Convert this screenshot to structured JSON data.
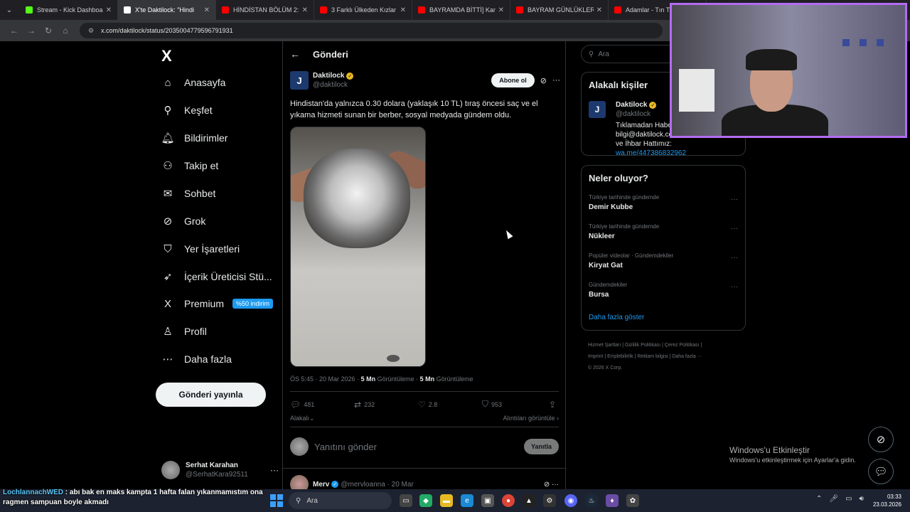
{
  "browser": {
    "tabs": [
      {
        "title": "Stream - Kick Dashboard",
        "color": "#53fc18",
        "active": false
      },
      {
        "title": "X'te Daktilock: \"Hindi",
        "color": "#ffffff",
        "active": true
      },
      {
        "title": "HİNDİSTAN BÖLÜM 2: VA",
        "color": "#ff0000",
        "active": false
      },
      {
        "title": "3 Farklı Ülkeden Kızlar Arı",
        "color": "#ff0000",
        "active": false
      },
      {
        "title": "BAYRAMDA BİTTİ] Kanser",
        "color": "#ff0000",
        "active": false
      },
      {
        "title": "BAYRAM GÜNLÜKLERİ 🔵",
        "color": "#ff0000",
        "active": false
      },
      {
        "title": "Adamlar - Tın Tın (O",
        "color": "#ff0000",
        "active": false
      }
    ],
    "url": "x.com/daktilock/status/2035004779596791931"
  },
  "sidebar": {
    "logo": "X",
    "items": [
      {
        "label": "Anasayfa",
        "icon": "home-icon",
        "glyph": "⌂"
      },
      {
        "label": "Keşfet",
        "icon": "search-icon",
        "glyph": "⚲"
      },
      {
        "label": "Bildirimler",
        "icon": "bell-icon",
        "glyph": "🔔︎"
      },
      {
        "label": "Takip et",
        "icon": "add-person-icon",
        "glyph": "⚇"
      },
      {
        "label": "Sohbet",
        "icon": "envelope-icon",
        "glyph": "✉"
      },
      {
        "label": "Grok",
        "icon": "grok-icon",
        "glyph": "⊘"
      },
      {
        "label": "Yer İşaretleri",
        "icon": "bookmark-icon",
        "glyph": "⛉"
      },
      {
        "label": "İçerik Üreticisi Stü...",
        "icon": "rocket-icon",
        "glyph": "➶"
      },
      {
        "label": "Premium",
        "icon": "x-premium-icon",
        "glyph": "X"
      },
      {
        "label": "Profil",
        "icon": "person-icon",
        "glyph": "♙"
      },
      {
        "label": "Daha fazla",
        "icon": "more-circle-icon",
        "glyph": "⋯"
      }
    ],
    "premium_badge": "%50 indirim",
    "post_button": "Gönderi yayınla",
    "user": {
      "name": "Serhat Karahan",
      "handle": "@SerhatKara92511",
      "more": "···"
    }
  },
  "main": {
    "header": {
      "title": "Gönderi",
      "back": "←"
    },
    "post": {
      "author": "Daktilock",
      "handle": "@daktilock",
      "avatar_letter": "J",
      "subscribe": "Abone ol",
      "text": "Hindistan'da yalnızca 0.30 dolara (yaklaşık 10 TL) tıraş öncesi saç ve el yıkama hizmeti sunan bir berber, sosyal medyada gündem oldu.",
      "time": "ÖS 5:45 · 20 Mar 2026 · ",
      "views_a": "5 Mn",
      "views_a_label": " Görüntüleme · ",
      "views_b": "5 Mn",
      "views_b_label": " Görüntüleme",
      "replies": "481",
      "reposts": "232",
      "likes": "2.8",
      "bookmarks": "953",
      "related": "Alakalı⌄",
      "quotes": "Alıntıları görüntüle ›"
    },
    "reply_box": {
      "placeholder": "Yanıtını gönder",
      "button": "Yanıtla"
    },
    "comment": {
      "name": "Merv",
      "handle": "@mervloanna · 20 Mar",
      "right": "⊘  ···"
    }
  },
  "right": {
    "search_placeholder": "Ara",
    "relevant": {
      "title": "Alakalı kişiler",
      "name": "Daktilock",
      "handle": "@daktilock",
      "bio": "Tıklamadan Haberin... bilgi@daktilock.com |. Whatsapp İletişim ve İhbar Hattımız: ",
      "bio_link": "wa.me/447386832962"
    },
    "trends": {
      "title": "Neler oluyor?",
      "items": [
        {
          "context": "Türkiye tarihinde gündemde",
          "name": "Demir Kubbe"
        },
        {
          "context": "Türkiye tarihinde gündemde",
          "name": "Nükleer"
        },
        {
          "context": "Popüler videolar · Gündemdekiler",
          "name": "Kiryat Gat"
        },
        {
          "context": "Gündemdekiler",
          "name": "Bursa"
        }
      ],
      "show_more": "Daha fazla göster"
    },
    "footer": {
      "line1": "Hizmet Şartları  |  Gizlilik Politikası  |  Çerez Politikası  |",
      "line2": "Imprint  |  Erişilebilirlik  |  Reklam bilgisi  |  Daha fazla ···",
      "line3": "© 2026 X Corp."
    }
  },
  "windows_activation": {
    "title": "Windows'u Etkinleştir",
    "subtitle": "Windows'u etkinleştirmek için Ayarlar'a gidin."
  },
  "chat_overlay": {
    "user": "LochlannachWED",
    "message": " : abı bak en maks kampta 1 hafta falan yıkanmamıstım ona ragmen sampuan boyle akmadı"
  },
  "taskbar": {
    "search": "Ara",
    "time": "03:33",
    "date": "23.03.2026"
  }
}
